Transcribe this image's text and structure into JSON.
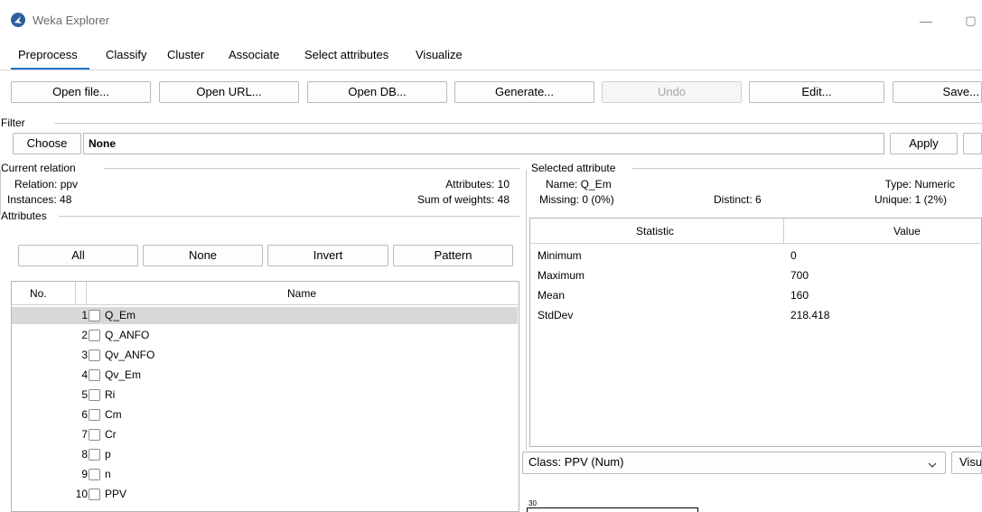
{
  "window": {
    "title": "Weka Explorer",
    "minimize_glyph": "—",
    "maximize_glyph": "▢"
  },
  "tabs": [
    {
      "label": "Preprocess",
      "active": true
    },
    {
      "label": "Classify"
    },
    {
      "label": "Cluster"
    },
    {
      "label": "Associate"
    },
    {
      "label": "Select attributes"
    },
    {
      "label": "Visualize"
    }
  ],
  "toolbar": {
    "open_file": "Open file...",
    "open_url": "Open URL...",
    "open_db": "Open DB...",
    "generate": "Generate...",
    "undo": "Undo",
    "edit": "Edit...",
    "save": "Save..."
  },
  "filter": {
    "section": "Filter",
    "choose": "Choose",
    "value": "None",
    "apply": "Apply"
  },
  "current_relation": {
    "section": "Current relation",
    "relation": "Relation: ppv",
    "instances": "Instances: 48",
    "attributes": "Attributes: 10",
    "sum_of_weights": "Sum of weights: 48"
  },
  "attributes": {
    "section": "Attributes",
    "buttons": {
      "all": "All",
      "none": "None",
      "invert": "Invert",
      "pattern": "Pattern"
    },
    "col_no": "No.",
    "col_name": "Name",
    "rows": [
      {
        "no": "1",
        "name": "Q_Em"
      },
      {
        "no": "2",
        "name": "Q_ANFO"
      },
      {
        "no": "3",
        "name": "Qv_ANFO"
      },
      {
        "no": "4",
        "name": "Qv_Em"
      },
      {
        "no": "5",
        "name": "Ri"
      },
      {
        "no": "6",
        "name": "Cm"
      },
      {
        "no": "7",
        "name": "Cr"
      },
      {
        "no": "8",
        "name": "p"
      },
      {
        "no": "9",
        "name": "n"
      },
      {
        "no": "10",
        "name": "PPV"
      }
    ]
  },
  "selected_attribute": {
    "section": "Selected attribute",
    "name": "Name: Q_Em",
    "type": "Type: Numeric",
    "missing": "Missing: 0 (0%)",
    "distinct": "Distinct: 6",
    "unique": "Unique: 1 (2%)",
    "col_statistic": "Statistic",
    "col_value": "Value",
    "stats": [
      {
        "statistic": "Minimum",
        "value": "0"
      },
      {
        "statistic": "Maximum",
        "value": "700"
      },
      {
        "statistic": "Mean",
        "value": "160"
      },
      {
        "statistic": "StdDev",
        "value": "218.418"
      }
    ]
  },
  "class_selector": {
    "value": "Class: PPV (Num)",
    "visualize": "Visu"
  },
  "histogram": {
    "top_count": "30"
  }
}
